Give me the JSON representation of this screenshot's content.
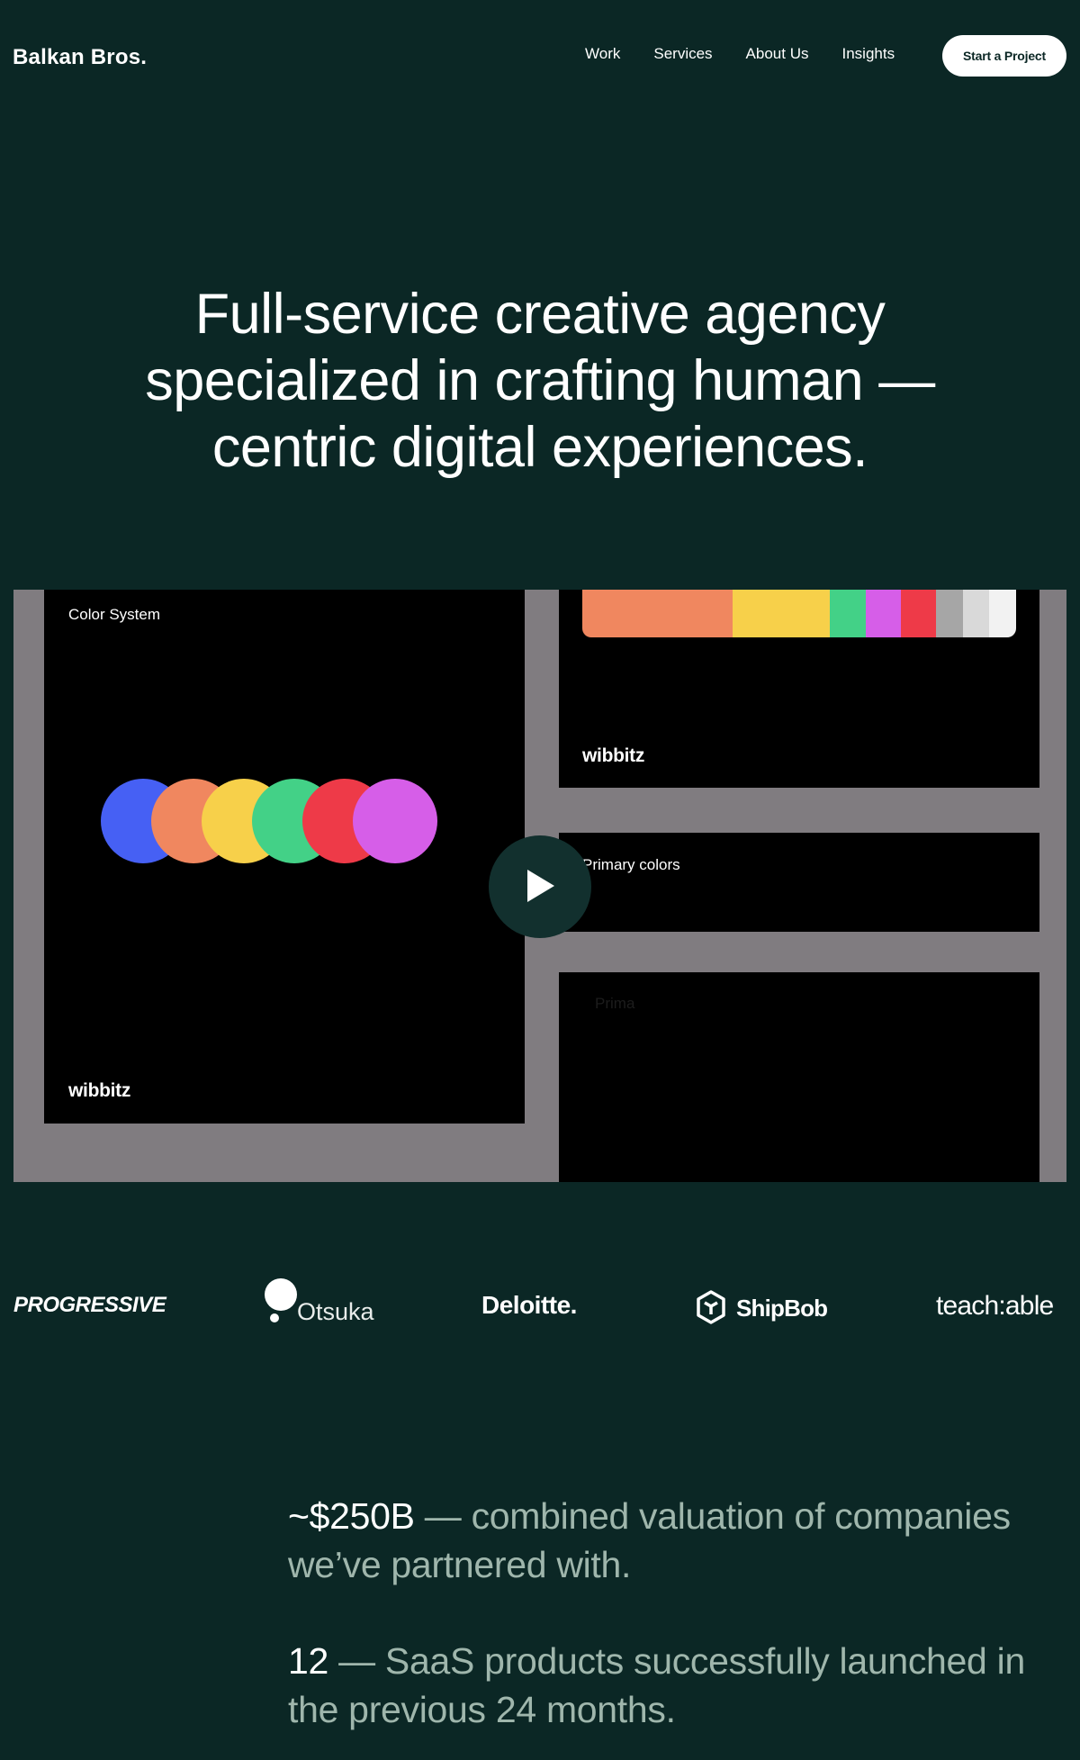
{
  "nav": {
    "logo": "Balkan Bros.",
    "links": [
      "Work",
      "Services",
      "About Us",
      "Insights"
    ],
    "cta": "Start a Project"
  },
  "hero": {
    "lines": [
      "Full-service creative agency",
      "specialized in crafting human —",
      "centric digital experiences."
    ]
  },
  "video": {
    "color_system_label": "Color System",
    "brand": "wibbitz",
    "primary_colors_label": "Primary colors",
    "faint_label": "Prima",
    "circle_colors": [
      "#4660f4",
      "#f0875f",
      "#f7d04a",
      "#43d187",
      "#ee3a48",
      "#d65ee8"
    ],
    "palette_colors": [
      "#f0875f",
      "#f7d04a",
      "#43d187",
      "#d65ee8",
      "#ee3a48",
      "#a6a6a6",
      "#d9d9d9",
      "#f2f2f2"
    ],
    "palette_weights": [
      17,
      11,
      4,
      4,
      4,
      3,
      3,
      3
    ]
  },
  "clients": {
    "progressive": "PROGRESSIVE",
    "otsuka": "Otsuka",
    "deloitte": "Deloitte.",
    "shipbob": "ShipBob",
    "teachable": "teach:able"
  },
  "stats": [
    {
      "number": "~$250B",
      "text": " — combined valuation of companies we’ve partnered with."
    },
    {
      "number": "12",
      "text": " — SaaS products successfully launched in the previous 24 months."
    }
  ]
}
